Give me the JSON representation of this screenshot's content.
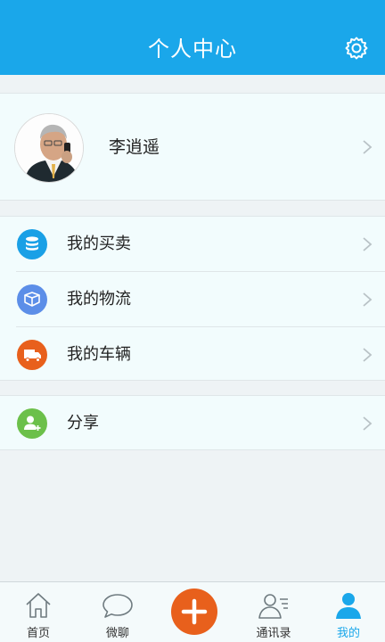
{
  "header": {
    "title": "个人中心",
    "settings_icon": "gear-icon"
  },
  "profile": {
    "name": "李逍遥"
  },
  "menu": {
    "items": [
      {
        "label": "我的买卖",
        "icon": "coin-stack-icon",
        "color": "#1aa0e6"
      },
      {
        "label": "我的物流",
        "icon": "package-box-icon",
        "color": "#5c8ee8"
      },
      {
        "label": "我的车辆",
        "icon": "truck-icon",
        "color": "#e8601c"
      }
    ],
    "share": {
      "label": "分享",
      "icon": "add-user-icon",
      "color": "#6cc04a"
    }
  },
  "tabbar": {
    "items": [
      {
        "label": "首页",
        "icon": "home-icon"
      },
      {
        "label": "微聊",
        "icon": "chat-bubble-icon"
      },
      {
        "label": "",
        "icon": "plus-icon"
      },
      {
        "label": "通讯录",
        "icon": "contacts-icon"
      },
      {
        "label": "我的",
        "icon": "user-icon",
        "active": true
      }
    ]
  },
  "colors": {
    "accent": "#1aa7ea",
    "orange": "#e8601c",
    "green": "#6cc04a"
  }
}
